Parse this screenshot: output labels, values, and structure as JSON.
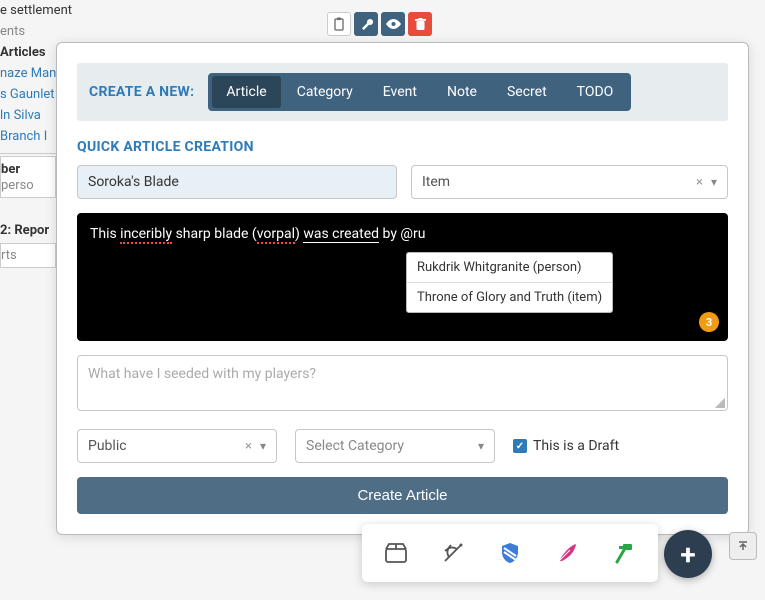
{
  "bg": {
    "settlement": "e settlement",
    "ents": "ents",
    "articles_heading": "Articles",
    "links": [
      "naze Man",
      "s Gaunlet",
      "ln Silva",
      "Branch I"
    ],
    "ber": "ber",
    "perso": "perso",
    "report": "2: Repor",
    "rts": "rts"
  },
  "toolbar_icons": {
    "clipboard": "clipboard",
    "wrench": "wrench",
    "eye": "eye",
    "trash": "trash"
  },
  "create": {
    "label": "CREATE A NEW:",
    "tabs": [
      "Article",
      "Category",
      "Event",
      "Note",
      "Secret",
      "TODO"
    ],
    "active_tab": 0
  },
  "section_label": "QUICK ARTICLE CREATION",
  "title": "Soroka's Blade",
  "template": {
    "selected": "Item",
    "clearable": true
  },
  "editor": {
    "content_parts": {
      "p1": "This ",
      "spell1": "inceribly",
      "p2": " sharp blade (",
      "spell2": "vorpal",
      "p3": ") ",
      "link1": "was created",
      "p4": " by @ru"
    },
    "badge": "3",
    "mentions": [
      "Rukdrik Whitgranite (person)",
      "Throne of Glory and Truth (item)"
    ]
  },
  "seed_placeholder": "What have I seeded with my players?",
  "visibility": {
    "selected": "Public"
  },
  "category": {
    "placeholder": "Select Category"
  },
  "draft_label": "This is a Draft",
  "draft_checked": true,
  "submit_label": "Create Article",
  "float_icons": [
    "box",
    "crossbow",
    "shield",
    "quill",
    "hammer"
  ],
  "colors": {
    "accent": "#2e7bb8",
    "header_blue": "#3f627f",
    "danger": "#e74c3c",
    "badge": "#f39c12"
  }
}
